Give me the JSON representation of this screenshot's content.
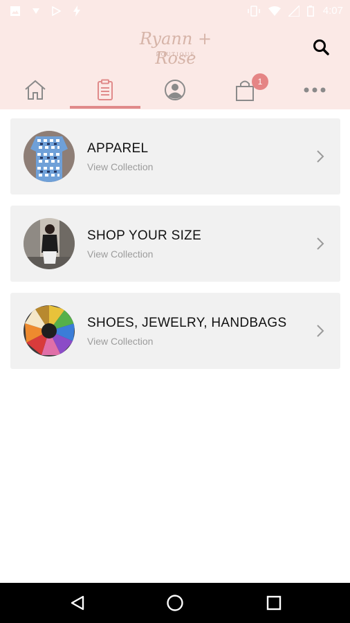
{
  "status_bar": {
    "time": "4:07"
  },
  "header": {
    "logo_script": "Ryann + Rose",
    "logo_sub": "BOUTIQUE"
  },
  "tabs": [
    {
      "name": "home-icon",
      "active": false
    },
    {
      "name": "clipboard-icon",
      "active": true
    },
    {
      "name": "account-icon",
      "active": false
    },
    {
      "name": "shopping-bag-icon",
      "active": false,
      "badge": "1"
    },
    {
      "name": "more-icon",
      "active": false
    }
  ],
  "cart_badge": "1",
  "collections": [
    {
      "title": "APPAREL",
      "subtitle": "View Collection"
    },
    {
      "title": "SHOP YOUR SIZE",
      "subtitle": "View Collection"
    },
    {
      "title": "SHOES, JEWELRY, HANDBAGS",
      "subtitle": "View Collection"
    }
  ],
  "colors": {
    "header_bg": "#fbe9e6",
    "accent": "#e08a8a",
    "card_bg": "#f1f1f1"
  }
}
